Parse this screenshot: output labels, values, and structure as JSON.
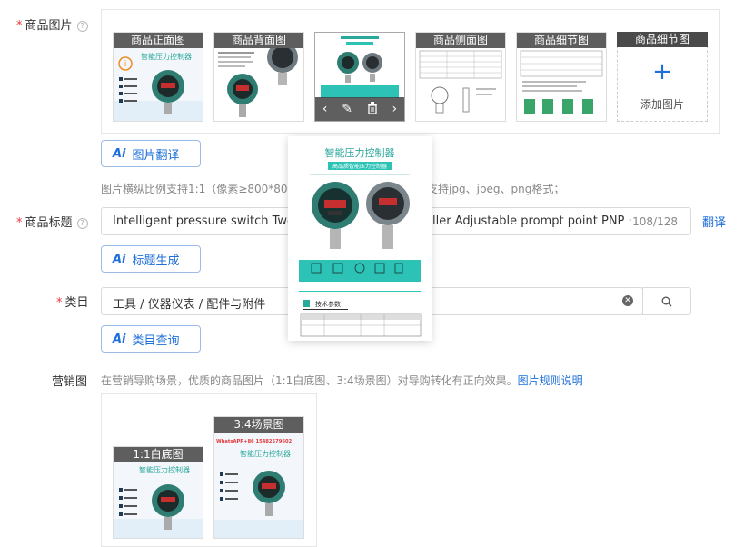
{
  "product_images": {
    "label": "商品图片",
    "thumbs": [
      {
        "caption": "商品正面图"
      },
      {
        "caption": "商品背面图"
      },
      {
        "caption": ""
      },
      {
        "caption": "商品侧面图"
      },
      {
        "caption": "商品细节图"
      }
    ],
    "add_caption": "商品细节图",
    "add_plus": "+",
    "add_text": "添加图片",
    "translate_button": "图片翻译",
    "hint": "图片横纵比例支持1:1（像素≥800*800）",
    "hint_tail": "支持jpg、jpeg、png格式；"
  },
  "preview": {
    "title": "智能压力控制器",
    "subtitle_band": "高品质智能压力控制器",
    "tab_label": "技术参数",
    "small_caption": "产品参数"
  },
  "product_title": {
    "label": "商品标题",
    "value_left": "Intelligent pressure switch Two-",
    "value_right": "ller Adjustable prompt point PNP ·",
    "counter": "108/128",
    "translate_link": "翻译",
    "generate_button": "标题生成"
  },
  "category": {
    "label": "类目",
    "value": "工具 / 仪器仪表 / 配件与附件",
    "query_button": "类目查询"
  },
  "marketing": {
    "label": "营销图",
    "desc": "在营销导购场景，优质的商品图片（1:1白底图、3:4场景图）对导购转化有正向效果。",
    "rules_link": "图片规则说明",
    "white_caption": "1:1白底图",
    "scene_caption": "3:4场景图",
    "scene_red_text": "WhatsAPP+86 15482579602"
  },
  "thumb_text": {
    "front_title": "智能压力控制器",
    "scene_title": "智能压力控制器"
  },
  "colors": {
    "accent": "#1e6fd9",
    "required": "#e4393c",
    "device_green": "#2f7d72",
    "teal_band": "#2cc3b6"
  }
}
